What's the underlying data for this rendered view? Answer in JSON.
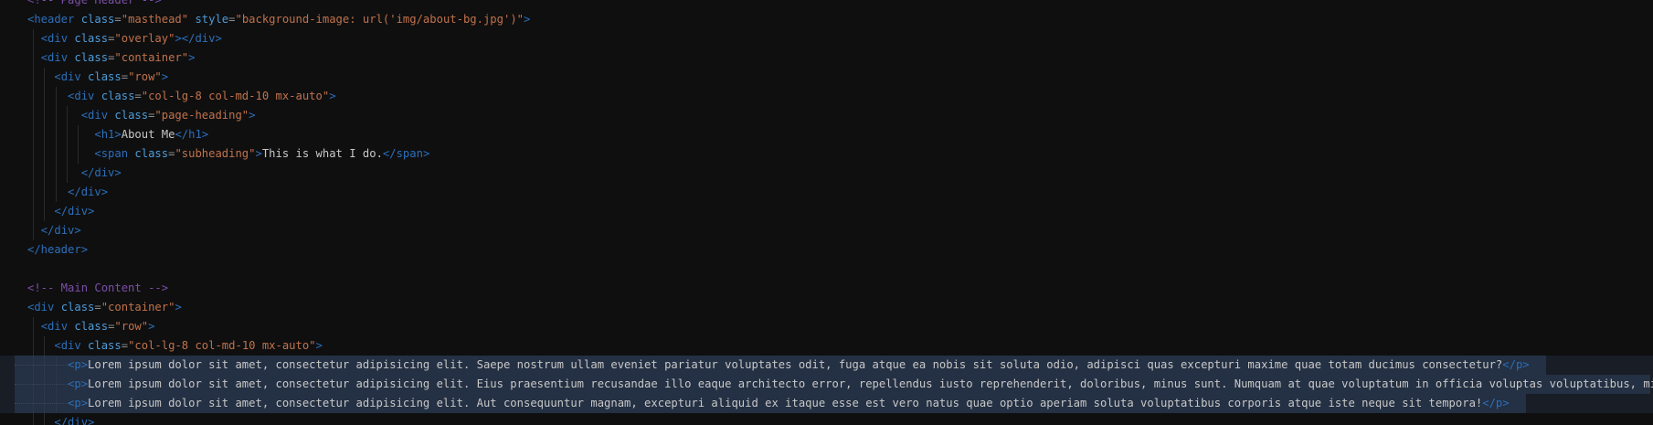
{
  "theme": {
    "background": "#0f0f10",
    "comment_color": "#7b4fa6",
    "tag_color": "#2c6fb8",
    "attr_color": "#4e9bd6",
    "string_color": "#c0724a",
    "text_color": "#c8c8c8",
    "selection_color": "#2a3a50"
  },
  "code": {
    "lines": [
      {
        "indent": 0,
        "tokens": [
          {
            "t": "cmt",
            "v": "<!-- Page Header -->"
          }
        ]
      },
      {
        "indent": 0,
        "tokens": [
          {
            "t": "tag",
            "v": "<header "
          },
          {
            "t": "attr",
            "v": "class"
          },
          {
            "t": "punc",
            "v": "="
          },
          {
            "t": "str",
            "v": "\"masthead\""
          },
          {
            "t": "attr",
            "v": " style"
          },
          {
            "t": "punc",
            "v": "="
          },
          {
            "t": "str",
            "v": "\"background-image: url('img/about-bg.jpg')\""
          },
          {
            "t": "tag",
            "v": ">"
          }
        ]
      },
      {
        "indent": 1,
        "tokens": [
          {
            "t": "tag",
            "v": "<div "
          },
          {
            "t": "attr",
            "v": "class"
          },
          {
            "t": "punc",
            "v": "="
          },
          {
            "t": "str",
            "v": "\"overlay\""
          },
          {
            "t": "tag",
            "v": "></div>"
          }
        ]
      },
      {
        "indent": 1,
        "tokens": [
          {
            "t": "tag",
            "v": "<div "
          },
          {
            "t": "attr",
            "v": "class"
          },
          {
            "t": "punc",
            "v": "="
          },
          {
            "t": "str",
            "v": "\"container\""
          },
          {
            "t": "tag",
            "v": ">"
          }
        ]
      },
      {
        "indent": 2,
        "tokens": [
          {
            "t": "tag",
            "v": "<div "
          },
          {
            "t": "attr",
            "v": "class"
          },
          {
            "t": "punc",
            "v": "="
          },
          {
            "t": "str",
            "v": "\"row\""
          },
          {
            "t": "tag",
            "v": ">"
          }
        ]
      },
      {
        "indent": 3,
        "tokens": [
          {
            "t": "tag",
            "v": "<div "
          },
          {
            "t": "attr",
            "v": "class"
          },
          {
            "t": "punc",
            "v": "="
          },
          {
            "t": "str",
            "v": "\"col-lg-8 col-md-10 mx-auto\""
          },
          {
            "t": "tag",
            "v": ">"
          }
        ]
      },
      {
        "indent": 4,
        "tokens": [
          {
            "t": "tag",
            "v": "<div "
          },
          {
            "t": "attr",
            "v": "class"
          },
          {
            "t": "punc",
            "v": "="
          },
          {
            "t": "str",
            "v": "\"page-heading\""
          },
          {
            "t": "tag",
            "v": ">"
          }
        ]
      },
      {
        "indent": 5,
        "tokens": [
          {
            "t": "tag",
            "v": "<h1>"
          },
          {
            "t": "plain",
            "v": "About Me"
          },
          {
            "t": "tag",
            "v": "</h1>"
          }
        ]
      },
      {
        "indent": 5,
        "tokens": [
          {
            "t": "tag",
            "v": "<span "
          },
          {
            "t": "attr",
            "v": "class"
          },
          {
            "t": "punc",
            "v": "="
          },
          {
            "t": "str",
            "v": "\"subheading\""
          },
          {
            "t": "tag",
            "v": ">"
          },
          {
            "t": "plain",
            "v": "This is what I do."
          },
          {
            "t": "tag",
            "v": "</span>"
          }
        ]
      },
      {
        "indent": 4,
        "tokens": [
          {
            "t": "tag",
            "v": "</div>"
          }
        ]
      },
      {
        "indent": 3,
        "tokens": [
          {
            "t": "tag",
            "v": "</div>"
          }
        ]
      },
      {
        "indent": 2,
        "tokens": [
          {
            "t": "tag",
            "v": "</div>"
          }
        ]
      },
      {
        "indent": 1,
        "tokens": [
          {
            "t": "tag",
            "v": "</div>"
          }
        ]
      },
      {
        "indent": 0,
        "tokens": [
          {
            "t": "tag",
            "v": "</header>"
          }
        ]
      },
      {
        "indent": 0,
        "tokens": []
      },
      {
        "indent": 0,
        "tokens": [
          {
            "t": "cmt",
            "v": "<!-- Main Content -->"
          }
        ]
      },
      {
        "indent": 0,
        "tokens": [
          {
            "t": "tag",
            "v": "<div "
          },
          {
            "t": "attr",
            "v": "class"
          },
          {
            "t": "punc",
            "v": "="
          },
          {
            "t": "str",
            "v": "\"container\""
          },
          {
            "t": "tag",
            "v": ">"
          }
        ]
      },
      {
        "indent": 1,
        "tokens": [
          {
            "t": "tag",
            "v": "<div "
          },
          {
            "t": "attr",
            "v": "class"
          },
          {
            "t": "punc",
            "v": "="
          },
          {
            "t": "str",
            "v": "\"row\""
          },
          {
            "t": "tag",
            "v": ">"
          }
        ]
      },
      {
        "indent": 2,
        "tokens": [
          {
            "t": "tag",
            "v": "<div "
          },
          {
            "t": "attr",
            "v": "class"
          },
          {
            "t": "punc",
            "v": "="
          },
          {
            "t": "str",
            "v": "\"col-lg-8 col-md-10 mx-auto\""
          },
          {
            "t": "tag",
            "v": ">"
          }
        ]
      },
      {
        "indent": 3,
        "selected": true,
        "tokens": [
          {
            "t": "tag",
            "v": "<p>"
          },
          {
            "t": "plain",
            "v": "Lorem ipsum dolor sit amet, consectetur adipisicing elit. Saepe nostrum ullam eveniet pariatur voluptates odit, fuga atque ea nobis sit soluta odio, adipisci quas excepturi maxime quae totam ducimus consectetur?"
          },
          {
            "t": "tag",
            "v": "</p>"
          }
        ]
      },
      {
        "indent": 3,
        "selected": true,
        "tokens": [
          {
            "t": "tag",
            "v": "<p>"
          },
          {
            "t": "plain",
            "v": "Lorem ipsum dolor sit amet, consectetur adipisicing elit. Eius praesentium recusandae illo eaque architecto error, repellendus iusto reprehenderit, doloribus, minus sunt. Numquam at quae voluptatum in officia voluptas voluptatibus, minus!"
          },
          {
            "t": "tag",
            "v": "</p>"
          }
        ]
      },
      {
        "indent": 3,
        "selected": true,
        "tokens": [
          {
            "t": "tag",
            "v": "<p>"
          },
          {
            "t": "plain",
            "v": "Lorem ipsum dolor sit amet, consectetur adipisicing elit. Aut consequuntur magnam, excepturi aliquid ex itaque esse est vero natus quae optio aperiam soluta voluptatibus corporis atque iste neque sit tempora!"
          },
          {
            "t": "tag",
            "v": "</p>"
          }
        ]
      },
      {
        "indent": 2,
        "tokens": [
          {
            "t": "tag",
            "v": "</div>"
          }
        ]
      }
    ]
  }
}
